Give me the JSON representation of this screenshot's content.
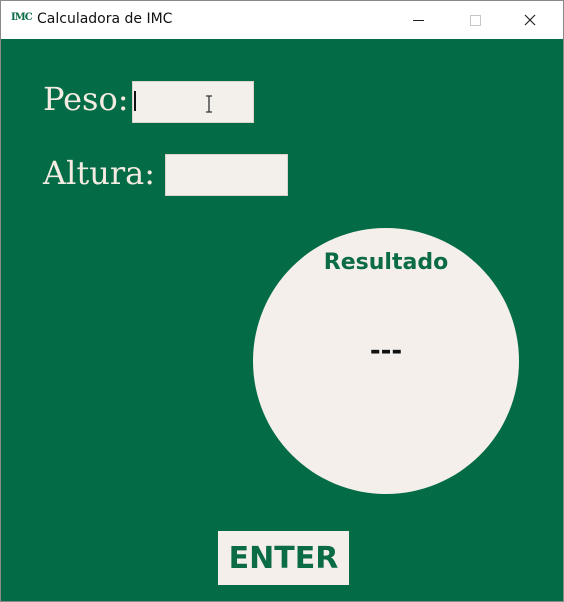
{
  "window": {
    "title": "Calculadora de IMC",
    "icon_text": "IMC"
  },
  "form": {
    "peso_label": "Peso:",
    "peso_value": "",
    "altura_label": "Altura:",
    "altura_value": ""
  },
  "result": {
    "title": "Resultado",
    "value": "---"
  },
  "actions": {
    "enter_label": "ENTER"
  },
  "colors": {
    "background": "#036b45",
    "accent": "#0a6b45",
    "surface": "#f4efea",
    "label_text": "#f4ece2"
  }
}
